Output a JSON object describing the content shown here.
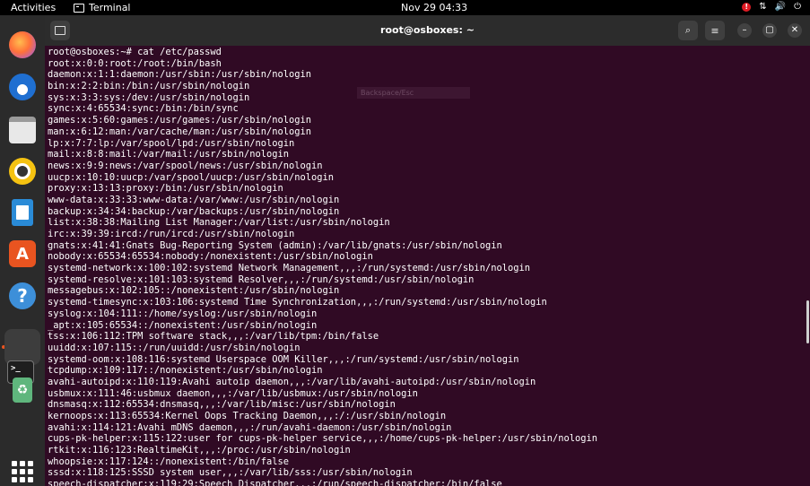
{
  "topbar": {
    "activities": "Activities",
    "app_name": "Terminal",
    "clock": "Nov 29  04:33",
    "alert": "!",
    "network_glyph": "⇅",
    "volume_glyph": "🔊",
    "power_glyph": "⏻"
  },
  "dock": {
    "items": [
      "firefox-icon",
      "thunderbird-icon",
      "files-icon",
      "rhythmbox-icon",
      "libreoffice-writer-icon",
      "ubuntu-software-icon",
      "help-icon",
      "terminal-icon",
      "trash-icon",
      "show-apps-icon"
    ],
    "software_glyph": "A",
    "help_glyph": "?",
    "terminal_glyph": ">_",
    "trash_glyph": "♻"
  },
  "window": {
    "title": "root@osboxes: ~",
    "search_glyph": "⌕",
    "menu_glyph": "≡",
    "minimize_glyph": "–",
    "maximize_glyph": "▢",
    "close_glyph": "✕",
    "ghost_text": "Backspace/Esc"
  },
  "terminal": {
    "lines": [
      "root@osboxes:~# cat /etc/passwd",
      "root:x:0:0:root:/root:/bin/bash",
      "daemon:x:1:1:daemon:/usr/sbin:/usr/sbin/nologin",
      "bin:x:2:2:bin:/bin:/usr/sbin/nologin",
      "sys:x:3:3:sys:/dev:/usr/sbin/nologin",
      "sync:x:4:65534:sync:/bin:/bin/sync",
      "games:x:5:60:games:/usr/games:/usr/sbin/nologin",
      "man:x:6:12:man:/var/cache/man:/usr/sbin/nologin",
      "lp:x:7:7:lp:/var/spool/lpd:/usr/sbin/nologin",
      "mail:x:8:8:mail:/var/mail:/usr/sbin/nologin",
      "news:x:9:9:news:/var/spool/news:/usr/sbin/nologin",
      "uucp:x:10:10:uucp:/var/spool/uucp:/usr/sbin/nologin",
      "proxy:x:13:13:proxy:/bin:/usr/sbin/nologin",
      "www-data:x:33:33:www-data:/var/www:/usr/sbin/nologin",
      "backup:x:34:34:backup:/var/backups:/usr/sbin/nologin",
      "list:x:38:38:Mailing List Manager:/var/list:/usr/sbin/nologin",
      "irc:x:39:39:ircd:/run/ircd:/usr/sbin/nologin",
      "gnats:x:41:41:Gnats Bug-Reporting System (admin):/var/lib/gnats:/usr/sbin/nologin",
      "nobody:x:65534:65534:nobody:/nonexistent:/usr/sbin/nologin",
      "systemd-network:x:100:102:systemd Network Management,,,:/run/systemd:/usr/sbin/nologin",
      "systemd-resolve:x:101:103:systemd Resolver,,,:/run/systemd:/usr/sbin/nologin",
      "messagebus:x:102:105::/nonexistent:/usr/sbin/nologin",
      "systemd-timesync:x:103:106:systemd Time Synchronization,,,:/run/systemd:/usr/sbin/nologin",
      "syslog:x:104:111::/home/syslog:/usr/sbin/nologin",
      "_apt:x:105:65534::/nonexistent:/usr/sbin/nologin",
      "tss:x:106:112:TPM software stack,,,:/var/lib/tpm:/bin/false",
      "uuidd:x:107:115::/run/uuidd:/usr/sbin/nologin",
      "systemd-oom:x:108:116:systemd Userspace OOM Killer,,,:/run/systemd:/usr/sbin/nologin",
      "tcpdump:x:109:117::/nonexistent:/usr/sbin/nologin",
      "avahi-autoipd:x:110:119:Avahi autoip daemon,,,:/var/lib/avahi-autoipd:/usr/sbin/nologin",
      "usbmux:x:111:46:usbmux daemon,,,:/var/lib/usbmux:/usr/sbin/nologin",
      "dnsmasq:x:112:65534:dnsmasq,,,:/var/lib/misc:/usr/sbin/nologin",
      "kernoops:x:113:65534:Kernel Oops Tracking Daemon,,,:/:/usr/sbin/nologin",
      "avahi:x:114:121:Avahi mDNS daemon,,,:/run/avahi-daemon:/usr/sbin/nologin",
      "cups-pk-helper:x:115:122:user for cups-pk-helper service,,,:/home/cups-pk-helper:/usr/sbin/nologin",
      "rtkit:x:116:123:RealtimeKit,,,:/proc:/usr/sbin/nologin",
      "whoopsie:x:117:124::/nonexistent:/bin/false",
      "sssd:x:118:125:SSSD system user,,,:/var/lib/sss:/usr/sbin/nologin",
      "speech-dispatcher:x:119:29:Speech Dispatcher,,,:/run/speech-dispatcher:/bin/false"
    ]
  }
}
